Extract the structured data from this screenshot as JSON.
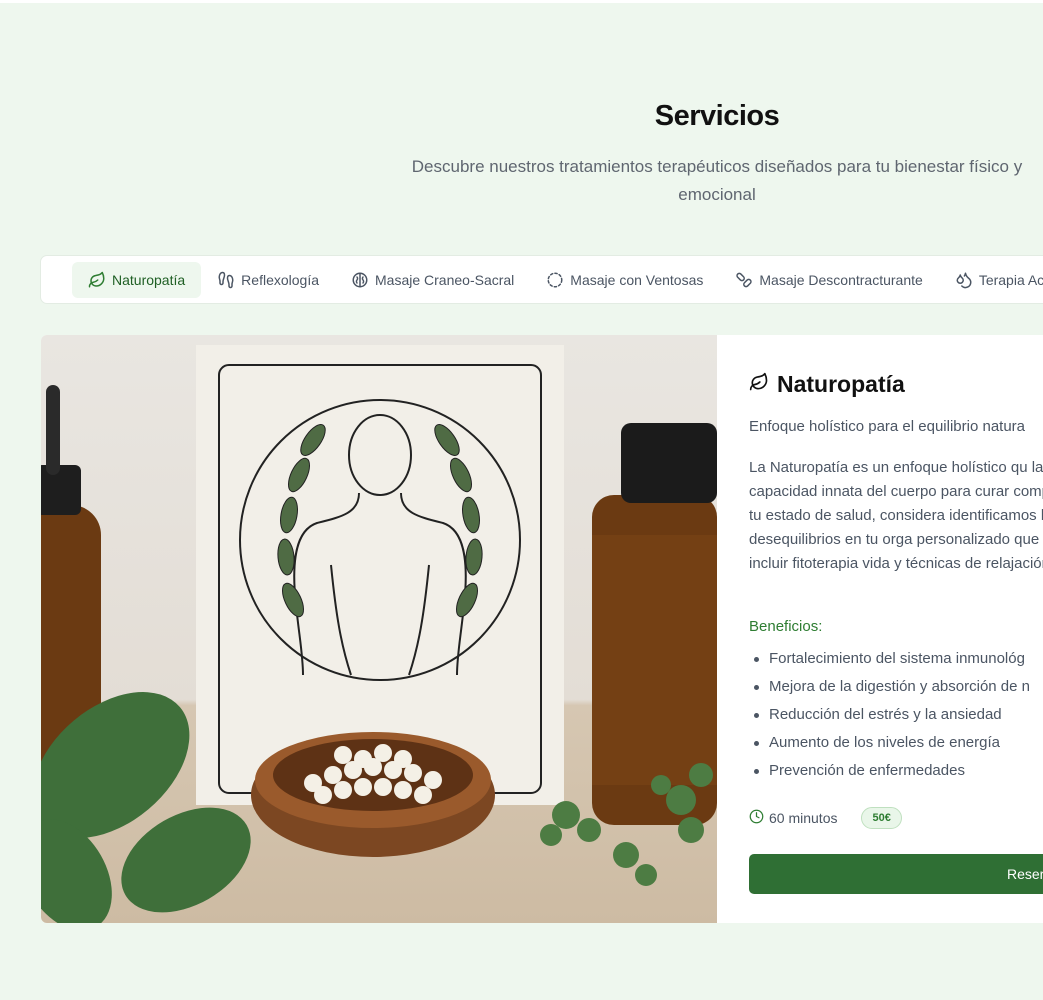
{
  "header": {
    "title": "Servicios",
    "subtitle": "Descubre nuestros tratamientos terapéuticos diseñados para tu bienestar físico y emocional"
  },
  "tabs": [
    {
      "label": "Naturopatía",
      "icon": "leaf-icon",
      "active": true
    },
    {
      "label": "Reflexología",
      "icon": "footprints-icon",
      "active": false
    },
    {
      "label": "Masaje Craneo-Sacral",
      "icon": "brain-icon",
      "active": false
    },
    {
      "label": "Masaje con Ventosas",
      "icon": "dashed-circle-icon",
      "active": false
    },
    {
      "label": "Masaje Descontracturante",
      "icon": "bandages-icon",
      "active": false
    },
    {
      "label": "Terapia Ac",
      "icon": "droplets-icon",
      "active": false
    }
  ],
  "service": {
    "title": "Naturopatía",
    "icon": "leaf-icon",
    "tagline": "Enfoque holístico para el equilibrio natura",
    "description": "La Naturopatía es un enfoque holístico qu la capacidad innata del cuerpo para curar completo de tu estado de salud, considera identificamos los desequilibrios en tu orga personalizado que puede incluir fitoterapia vida y técnicas de relajación.",
    "benefits_heading": "Beneficios:",
    "benefits": [
      "Fortalecimiento del sistema inmunológ",
      "Mejora de la digestión y absorción de n",
      "Reducción del estrés y la ansiedad",
      "Aumento de los niveles de energía",
      "Prevención de enfermedades"
    ],
    "duration": "60 minutos",
    "price": "50€",
    "book_label": "Reser"
  },
  "colors": {
    "background": "#eef7ee",
    "accent": "#2f6f34",
    "accent_text": "#2e7d32"
  }
}
